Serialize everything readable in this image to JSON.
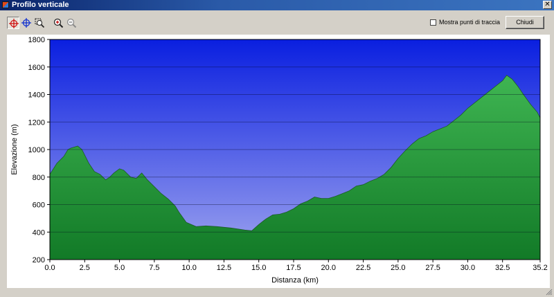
{
  "window": {
    "title": "Profilo verticale",
    "close_glyph": "✕"
  },
  "toolbar": {
    "buttons": [
      {
        "name": "crosshair-red-icon",
        "pressed": true
      },
      {
        "name": "crosshair-blue-icon",
        "pressed": false
      },
      {
        "name": "zoom-region-icon",
        "pressed": false
      },
      {
        "name": "zoom-in-icon",
        "pressed": false
      },
      {
        "name": "zoom-out-icon",
        "pressed": false
      }
    ],
    "show_points_label": "Mostra punti di traccia",
    "show_points_checked": false,
    "close_label": "Chiudi"
  },
  "chart_data": {
    "type": "area",
    "xlabel": "Distanza    (km)",
    "ylabel": "Elevazione  (m)",
    "xlim": [
      0,
      35.2
    ],
    "ylim": [
      200,
      1800
    ],
    "x_ticks": [
      "0.0",
      "2.5",
      "5.0",
      "7.5",
      "10.0",
      "12.5",
      "15.0",
      "17.5",
      "20.0",
      "22.5",
      "25.0",
      "27.5",
      "30.0",
      "32.5",
      "35.2"
    ],
    "y_ticks": [
      "200",
      "400",
      "600",
      "800",
      "1000",
      "1200",
      "1400",
      "1600",
      "1800"
    ],
    "grid": true,
    "background_gradient": [
      "#0a1fe0",
      "#9fa5ef"
    ],
    "fill_gradient": [
      "#3fb552",
      "#127a27"
    ],
    "series": [
      {
        "x": [
          0,
          0.5,
          1,
          1.3,
          1.5,
          2,
          2.3,
          2.8,
          3.2,
          3.6,
          4,
          4.3,
          4.6,
          5,
          5.3,
          5.8,
          6.2,
          6.6,
          7,
          7.5,
          8,
          8.5,
          9,
          9.3,
          9.8,
          10.5,
          11.2,
          12,
          13,
          14,
          14.5,
          15,
          15.5,
          16,
          16.5,
          17,
          17.5,
          18,
          18.5,
          19,
          19.5,
          20,
          20.5,
          21,
          21.5,
          22,
          22.5,
          23,
          23.5,
          24,
          24.5,
          25,
          25.5,
          26,
          26.5,
          27,
          27.5,
          28,
          28.5,
          29,
          29.5,
          30,
          30.5,
          31,
          31.5,
          32,
          32.5,
          32.8,
          33.2,
          33.6,
          34,
          34.5,
          35,
          35.2
        ],
        "y": [
          820,
          900,
          950,
          1000,
          1010,
          1025,
          1000,
          900,
          840,
          820,
          780,
          800,
          830,
          860,
          850,
          800,
          790,
          830,
          780,
          730,
          680,
          640,
          590,
          540,
          470,
          440,
          445,
          440,
          430,
          415,
          410,
          455,
          495,
          525,
          530,
          545,
          570,
          605,
          625,
          655,
          645,
          645,
          660,
          680,
          700,
          735,
          745,
          770,
          790,
          820,
          870,
          935,
          990,
          1040,
          1080,
          1100,
          1130,
          1150,
          1170,
          1210,
          1250,
          1300,
          1340,
          1380,
          1420,
          1460,
          1500,
          1540,
          1510,
          1460,
          1400,
          1330,
          1270,
          1230
        ]
      }
    ]
  }
}
